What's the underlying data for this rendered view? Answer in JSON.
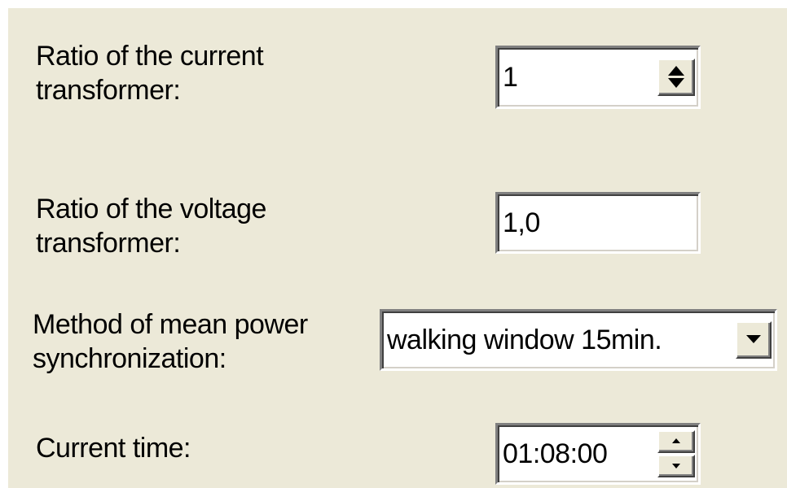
{
  "ct_ratio": {
    "label_line1": "Ratio of the current",
    "label_line2": "transformer:",
    "value": "1"
  },
  "vt_ratio": {
    "label_line1": "Ratio of the voltage",
    "label_line2": "transformer:",
    "value": "1,0"
  },
  "sync_method": {
    "label_line1": "Method of mean power",
    "label_line2": "synchronization:",
    "selected": "walking window 15min."
  },
  "current_time": {
    "label": "Current time:",
    "value": "01:08:00"
  },
  "icons": {
    "spin": "spin-arrows-icon",
    "dropdown": "chevron-down-icon"
  }
}
